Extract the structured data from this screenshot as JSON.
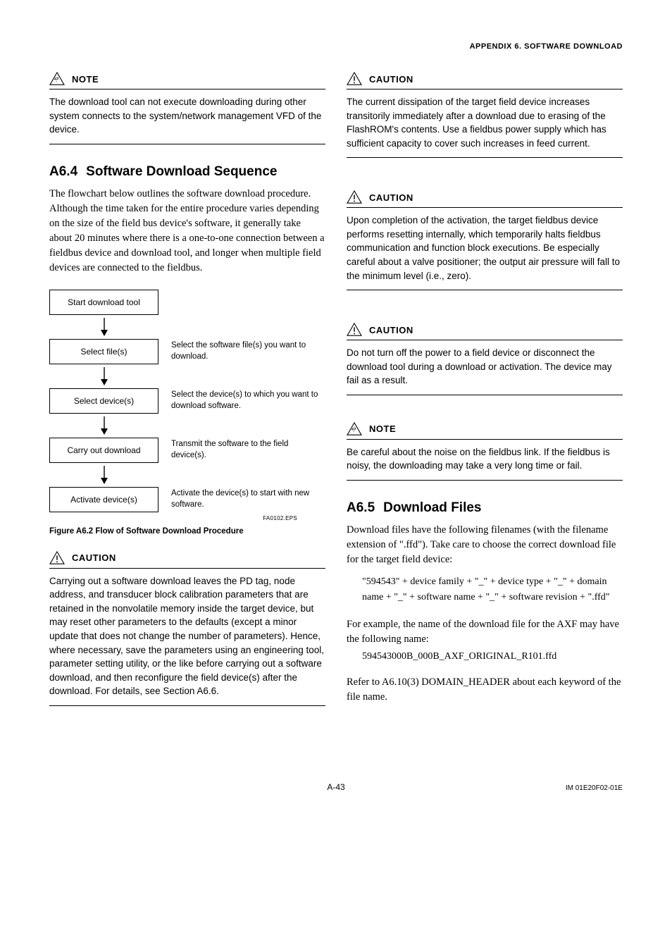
{
  "header": {
    "appendix_title": "APPENDIX 6. SOFTWARE DOWNLOAD"
  },
  "left": {
    "note1": {
      "title": "NOTE",
      "body": "The download tool can not execute downloading during other system connects to the system/network management VFD of the device."
    },
    "sec_a64": {
      "num": "A6.4",
      "title": "Software Download Sequence",
      "intro": "The flowchart below outlines the software download procedure.  Although the time taken for the entire procedure varies depending on the size of the field bus device's software, it generally take about 20 minutes where there is a one-to-one connection between a fieldbus device and download tool, and longer when multiple field devices are connected to the fieldbus."
    },
    "flow": {
      "steps": [
        {
          "box": "Start download tool",
          "desc": ""
        },
        {
          "box": "Select file(s)",
          "desc": "Select the software file(s) you want to download."
        },
        {
          "box": "Select device(s)",
          "desc": "Select the device(s) to which you want to download software."
        },
        {
          "box": "Carry out download",
          "desc": "Transmit the software to the field device(s)."
        },
        {
          "box": "Activate device(s)",
          "desc": "Activate the device(s) to start with new software."
        }
      ],
      "ref": "FA0102.EPS",
      "caption": "Figure A6.2   Flow of Software Download Procedure"
    },
    "caution1": {
      "title": "CAUTION",
      "body": "Carrying out a software download leaves the PD tag, node address, and transducer block calibration parameters that are retained in the nonvolatile memory inside the target device, but may reset other parameters to the defaults (except a minor update that does not change the number of parameters).  Hence, where necessary, save the parameters using an engineering tool, parameter setting utility, or the like before carrying out a software download, and then reconfigure the field device(s) after the download.  For details, see Section A6.6."
    }
  },
  "right": {
    "caution2": {
      "title": "CAUTION",
      "body": "The current dissipation of the target field device increases transitorily immediately after a download due to erasing of the FlashROM's contents. Use a fieldbus power supply which has sufficient capacity to cover such increases in feed current."
    },
    "caution3": {
      "title": "CAUTION",
      "body": "Upon completion of the activation, the target fieldbus device performs resetting internally, which temporarily halts fieldbus communication and function block executions.  Be especially careful about a valve positioner; the output air pressure will fall to the minimum level (i.e., zero)."
    },
    "caution4": {
      "title": "CAUTION",
      "body": "Do not turn off the power to a field device or disconnect the download tool during a download or activation.  The device may fail as a result."
    },
    "note2": {
      "title": "NOTE",
      "body": "Be careful about the noise on the fieldbus link. If the fieldbus is noisy, the downloading may take a very long time or fail."
    },
    "sec_a65": {
      "num": "A6.5",
      "title": "Download Files",
      "p1": "Download files have the following filenames (with the filename extension of \".ffd\").  Take care to choose the correct download file for the target field device:",
      "fname": "\"594543\" + device family + \"_\" + device type + \"_\" + domain name + \"_\" + software name + \"_\" + software revision + \".ffd\"",
      "p2": "For example, the name of the download file for the AXF may have the following name:",
      "example": "594543000B_000B_AXF_ORIGINAL_R101.ffd",
      "p3": "Refer to A6.10(3) DOMAIN_HEADER about each keyword of the file name."
    }
  },
  "footer": {
    "page": "A-43",
    "docid": "IM 01E20F02-01E"
  }
}
